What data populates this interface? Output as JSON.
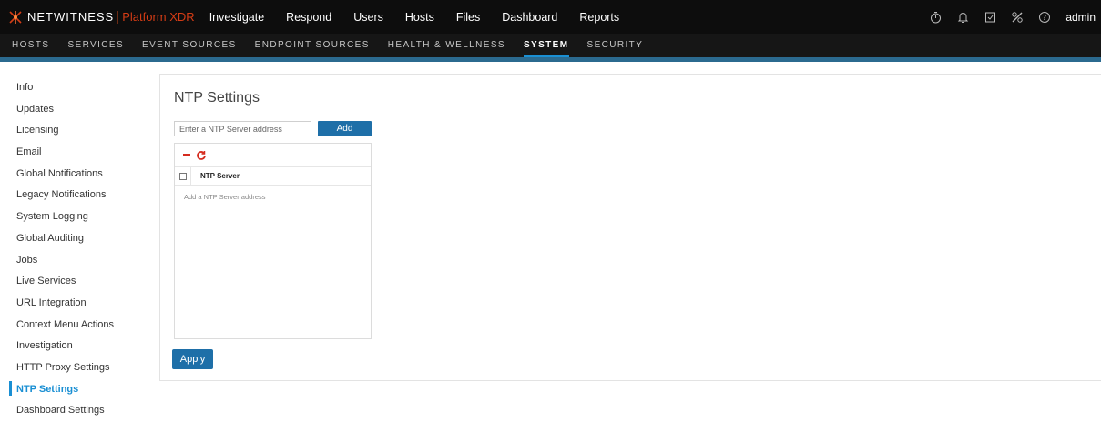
{
  "brand": {
    "name": "NETWITNESS",
    "product": "Platform XDR"
  },
  "main_nav": [
    {
      "label": "Investigate"
    },
    {
      "label": "Respond"
    },
    {
      "label": "Users"
    },
    {
      "label": "Hosts"
    },
    {
      "label": "Files"
    },
    {
      "label": "Dashboard"
    },
    {
      "label": "Reports"
    }
  ],
  "header_right": {
    "icons": [
      "stopwatch-icon",
      "bell-icon",
      "clipboard-icon",
      "tools-icon",
      "help-icon"
    ],
    "user": "admin"
  },
  "sub_nav": [
    {
      "label": "HOSTS"
    },
    {
      "label": "SERVICES"
    },
    {
      "label": "EVENT SOURCES"
    },
    {
      "label": "ENDPOINT SOURCES"
    },
    {
      "label": "HEALTH & WELLNESS"
    },
    {
      "label": "SYSTEM"
    },
    {
      "label": "SECURITY"
    }
  ],
  "sub_nav_active": "SYSTEM",
  "sidebar": {
    "items": [
      {
        "label": "Info"
      },
      {
        "label": "Updates"
      },
      {
        "label": "Licensing"
      },
      {
        "label": "Email"
      },
      {
        "label": "Global Notifications"
      },
      {
        "label": "Legacy Notifications"
      },
      {
        "label": "System Logging"
      },
      {
        "label": "Global Auditing"
      },
      {
        "label": "Jobs"
      },
      {
        "label": "Live Services"
      },
      {
        "label": "URL Integration"
      },
      {
        "label": "Context Menu Actions"
      },
      {
        "label": "Investigation"
      },
      {
        "label": "HTTP Proxy Settings"
      },
      {
        "label": "NTP Settings"
      },
      {
        "label": "Dashboard Settings"
      }
    ],
    "active": "NTP Settings"
  },
  "ntp": {
    "title": "NTP Settings",
    "input_placeholder": "Enter a NTP Server address",
    "input_value": "",
    "add_label": "Add",
    "grid_column": "NTP Server",
    "empty_text": "Add a NTP Server address",
    "apply_label": "Apply"
  },
  "colors": {
    "accent": "#1a8fd3",
    "button": "#1e6fa8",
    "brand_product": "#d43c15",
    "delete": "#d52b1e"
  }
}
